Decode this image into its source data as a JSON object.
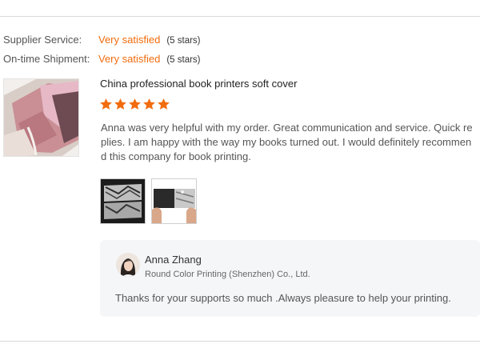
{
  "ratings": {
    "supplier_service": {
      "label": "Supplier Service:",
      "value": "Very satisfied",
      "stars_note": "(5 stars)"
    },
    "on_time_shipment": {
      "label": "On-time Shipment:",
      "value": "Very satisfied",
      "stars_note": "(5 stars)"
    }
  },
  "review": {
    "product_title": "China professional book printers soft cover",
    "star_rating": 5,
    "star_color": "#f26c0d",
    "text": "Anna was very helpful with my order. Great communication and service. Quick replies. I am happy with the way my books turned out. I would definitely recommend this company for book printing.",
    "image_count": 2
  },
  "reply": {
    "name": "Anna Zhang",
    "company": "Round Color Printing (Shenzhen) Co., Ltd.",
    "text": "Thanks for your supports so much .Always pleasure to help your printing."
  },
  "colors": {
    "accent": "#f26c0d",
    "reply_bg": "#f5f6f8",
    "divider": "#d9d9d9"
  }
}
